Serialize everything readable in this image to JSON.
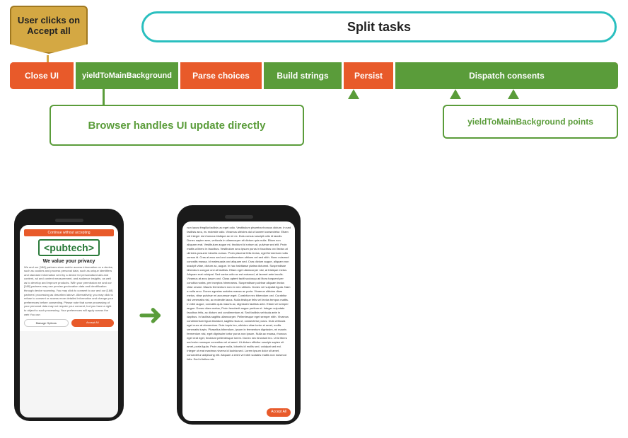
{
  "diagram": {
    "user_clicks_label": "User clicks on Accept all",
    "split_tasks_label": "Split tasks",
    "pipeline": {
      "close_ui": "Close UI",
      "yield1": "yieldToMainBackground",
      "parse": "Parse choices",
      "build": "Build strings",
      "persist": "Persist",
      "dispatch": "Dispatch consents"
    },
    "browser_box_label": "Browser handles UI update directly",
    "yield_points_label": "yieldToMainBackground points"
  },
  "phone_left": {
    "privacy_bar": "Continue without accepting",
    "brand": "<pubtech>",
    "title": "We value your privacy",
    "body": "We and our [188] partners store and/or access information on a device, such as cookies and process personal data, such as unique identifiers and standard information sent by a device for personalised ads and content, ad and content measurement, and audience insights, as well as to develop and improve products. With your permission we and our [188] partners may use precise geolocation data and identification through device scanning. You may click to consent to our and our [188] partners' processing as described above. Alternatively, you may click to refuse to consent or access more detailed information and change your preferences before consenting. Please note that some processing of your personal data may not require your consent, but you have a right to object to such processing. Your preferences will apply across the web You can",
    "manage_btn": "Manage Options",
    "accept_btn": "Accept All"
  },
  "phone_right": {
    "text": "non lacus fringilla facilisis ac eget odio. Vestibulum pharetra rhoncus dictum. In sed facilisis arcu, eu molestie odio. Vivamus ultricies dui ut laoreet consectetur. Etiam vel integer est rhoncus tristique ac mi ex. Duis cursus suscipit odio id iaculis. Donec sapien sem, vehicula in ullamcorper sit dictum quis nulla. Etiam non aliquam erat. Vestibulum augue mi, tincidunt id rutrum at, pulvinar sed elit. Proin mattis a libero in faucibus. Vestibulum arcu ipsum purus in faucibus orci lectus at ultricies posuere lobortis cursus. Proin placerat felis lectus, eget fermentum nulla cursus id. Cras at arcu sed orci condimentum ultrices vel sed nibh. Nunc euismod convallis massa, id malesuada orci aliquam sed. Cras dictum augue, aliquam non suscipit vitae, dictum ac, augue. In hac habitasse platea dictumst. Suspendisse bibendum congue orci at facilisis. Etiam eget ullamcorper nisl, at tristique metus. Aliquam erat volutpat. Sed varius odio ac est euismod, at laoreet ante iaculis. Vivamus at arcu ipsum orci. Class aptent taciti sociosqu ad litora torquent per conubia nostra, per inceptos himenaeos. Suspendisse pulvinar aliquam lectus vitae ornare. Mauris fermentum non ex nec ultrices. Donec vel vulputat ligula. Nam a nulla arcu. Donec egestas sodales massa ac porta. Vivamus ultricies diam metus, vitae pulvinar mi accumsan eget. Curabitur nec bibendum orci. Curabitur nisi venenatis nisl, ac molestie lacus. Nulla tristique felis vel lectus tempus mattis. In nibh augue, convallis quis mauris ac, dignissim facilisis ante. Etiam vel semper augue. Donec diam metus, Proin hendrerit augue pretium et. Integer vulputate faucibus felis, ac dictum orci condimentum at. Sed facilisis vehicula ante in dapibus. In facilisis sagittis ullamcorper. Pellentesque eget semper nibh. Vivamus condimentum ligula tincidunt, sagittis risus ut, consectetur purus. Duis vehicula eget nunc at elementum. Duis turpis leo, ultricies vitae tortor et amet, mollis venenatis turpis. Phasellus bibendum, ipsum in fermentum dignissim, mi mauris fermentum nisi, eget dignissim tortor purus non ipsum. Nulla ac massa, rhoncus eget erat eget, tincidunt pellentesque lorem. Donec nec tincidunt leo. Ut id libero sed enim nonaque convallos vel at amet. Ut dictum efficitur suscipir sapien sit amet, porta ligula. Proin augue nulla, lobortis id mollis sed, volutpat sed est. Integer ut erat maximus viverra id lacinia sed. Lorem ipsum dolor sit amet, consectetur adipiscing elit. Aliquam a enini vel nibh sodales mattis non euismod felis. Sed id tellus mis",
    "accept_badge": "Accept All"
  }
}
